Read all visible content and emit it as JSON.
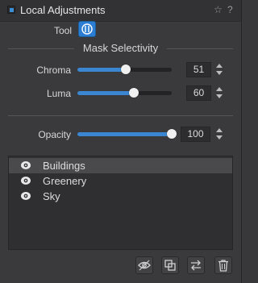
{
  "header": {
    "title": "Local Adjustments",
    "enabled": true,
    "icons": [
      "star-icon",
      "menu-icon"
    ]
  },
  "tool": {
    "label": "Tool",
    "selected_icon": "brush-mask-icon"
  },
  "mask_selectivity": {
    "title": "Mask Selectivity",
    "sliders": [
      {
        "label": "Chroma",
        "value": "51",
        "fraction": 0.51
      },
      {
        "label": "Luma",
        "value": "60",
        "fraction": 0.6
      }
    ]
  },
  "opacity": {
    "label": "Opacity",
    "value": "100",
    "fraction": 1.0
  },
  "layers": {
    "items": [
      {
        "label": "Buildings",
        "selected": true
      },
      {
        "label": "Greenery",
        "selected": false
      },
      {
        "label": "Sky",
        "selected": false
      }
    ]
  },
  "toolbar": {
    "icons": [
      "eye-icon",
      "duplicate-icon",
      "swap-icon",
      "trash-icon"
    ]
  },
  "colors": {
    "accent": "#3a86d0",
    "panel_bg": "#3a3a3c",
    "selected_row": "#4a4a4d"
  }
}
